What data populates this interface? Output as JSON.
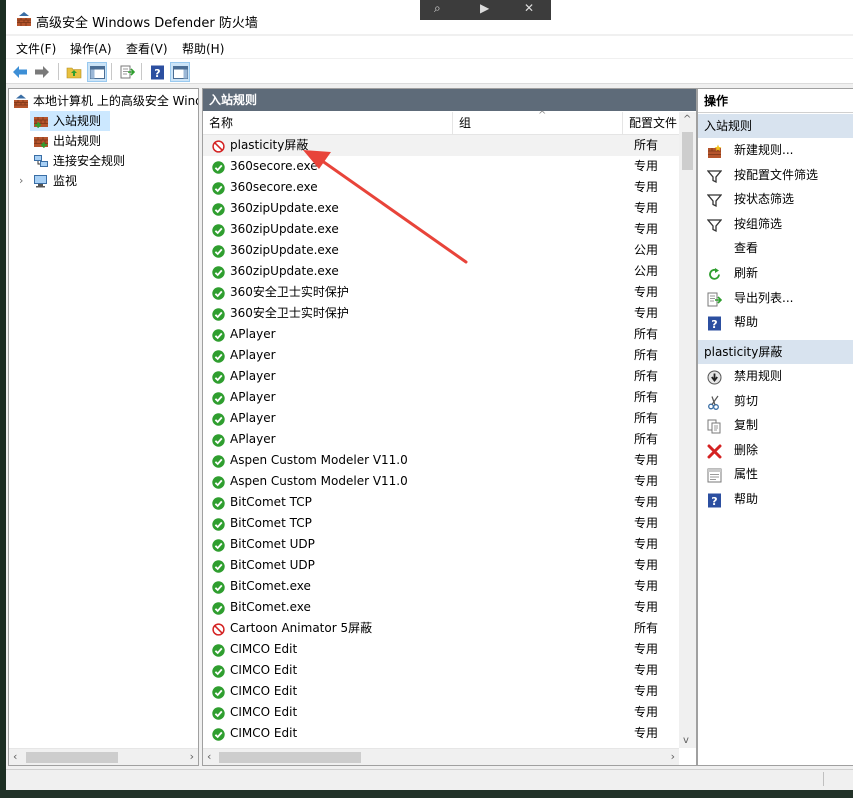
{
  "window": {
    "title": "高级安全 Windows Defender 防火墙",
    "overlay_controls": [
      "⌕",
      "▶",
      "✕"
    ]
  },
  "menu": [
    "文件(F)",
    "操作(A)",
    "查看(V)",
    "帮助(H)"
  ],
  "toolbar": {
    "icons": [
      "back-arrow-icon",
      "forward-arrow-icon",
      "up-folder-icon",
      "show-hide-tree-icon",
      "export-list-icon",
      "help-icon",
      "show-hide-action-pane-icon"
    ]
  },
  "tree": {
    "root": "本地计算机 上的高级安全 Windows Defender 防火墙",
    "items": [
      {
        "label": "入站规则",
        "icon": "inbound-rules-icon",
        "selected": true
      },
      {
        "label": "出站规则",
        "icon": "outbound-rules-icon",
        "selected": false
      },
      {
        "label": "连接安全规则",
        "icon": "connection-security-icon",
        "selected": false
      },
      {
        "label": "监视",
        "icon": "monitor-icon",
        "selected": false,
        "expandable": true
      }
    ]
  },
  "main": {
    "title": "入站规则",
    "columns": {
      "name": "名称",
      "group": "组",
      "profile": "配置文件"
    },
    "rows": [
      {
        "name": "plasticity屏蔽",
        "group": "",
        "profile": "所有",
        "status": "blocked",
        "highlighted": true
      },
      {
        "name": "360secore.exe",
        "group": "",
        "profile": "专用",
        "status": "allowed"
      },
      {
        "name": "360secore.exe",
        "group": "",
        "profile": "专用",
        "status": "allowed"
      },
      {
        "name": "360zipUpdate.exe",
        "group": "",
        "profile": "专用",
        "status": "allowed"
      },
      {
        "name": "360zipUpdate.exe",
        "group": "",
        "profile": "专用",
        "status": "allowed"
      },
      {
        "name": "360zipUpdate.exe",
        "group": "",
        "profile": "公用",
        "status": "allowed"
      },
      {
        "name": "360zipUpdate.exe",
        "group": "",
        "profile": "公用",
        "status": "allowed"
      },
      {
        "name": "360安全卫士实时保护",
        "group": "",
        "profile": "专用",
        "status": "allowed"
      },
      {
        "name": "360安全卫士实时保护",
        "group": "",
        "profile": "专用",
        "status": "allowed"
      },
      {
        "name": "APlayer",
        "group": "",
        "profile": "所有",
        "status": "allowed"
      },
      {
        "name": "APlayer",
        "group": "",
        "profile": "所有",
        "status": "allowed"
      },
      {
        "name": "APlayer",
        "group": "",
        "profile": "所有",
        "status": "allowed"
      },
      {
        "name": "APlayer",
        "group": "",
        "profile": "所有",
        "status": "allowed"
      },
      {
        "name": "APlayer",
        "group": "",
        "profile": "所有",
        "status": "allowed"
      },
      {
        "name": "APlayer",
        "group": "",
        "profile": "所有",
        "status": "allowed"
      },
      {
        "name": "Aspen Custom Modeler V11.0",
        "group": "",
        "profile": "专用",
        "status": "allowed"
      },
      {
        "name": "Aspen Custom Modeler V11.0",
        "group": "",
        "profile": "专用",
        "status": "allowed"
      },
      {
        "name": "BitComet TCP",
        "group": "",
        "profile": "专用",
        "status": "allowed"
      },
      {
        "name": "BitComet TCP",
        "group": "",
        "profile": "专用",
        "status": "allowed"
      },
      {
        "name": "BitComet UDP",
        "group": "",
        "profile": "专用",
        "status": "allowed"
      },
      {
        "name": "BitComet UDP",
        "group": "",
        "profile": "专用",
        "status": "allowed"
      },
      {
        "name": "BitComet.exe",
        "group": "",
        "profile": "专用",
        "status": "allowed"
      },
      {
        "name": "BitComet.exe",
        "group": "",
        "profile": "专用",
        "status": "allowed"
      },
      {
        "name": "Cartoon Animator 5屏蔽",
        "group": "",
        "profile": "所有",
        "status": "blocked"
      },
      {
        "name": "CIMCO Edit",
        "group": "",
        "profile": "专用",
        "status": "allowed"
      },
      {
        "name": "CIMCO Edit",
        "group": "",
        "profile": "专用",
        "status": "allowed"
      },
      {
        "name": "CIMCO Edit",
        "group": "",
        "profile": "专用",
        "status": "allowed"
      },
      {
        "name": "CIMCO Edit",
        "group": "",
        "profile": "专用",
        "status": "allowed"
      },
      {
        "name": "CIMCO Edit",
        "group": "",
        "profile": "专用",
        "status": "allowed"
      }
    ]
  },
  "actions": {
    "header": "操作",
    "section1": {
      "title": "入站规则",
      "items": [
        {
          "label": "新建规则...",
          "icon": "new-rule-icon"
        },
        {
          "label": "按配置文件筛选",
          "icon": "filter-icon"
        },
        {
          "label": "按状态筛选",
          "icon": "filter-icon"
        },
        {
          "label": "按组筛选",
          "icon": "filter-icon"
        },
        {
          "label": "查看",
          "icon": ""
        },
        {
          "label": "刷新",
          "icon": "refresh-icon"
        },
        {
          "label": "导出列表...",
          "icon": "export-list-icon"
        },
        {
          "label": "帮助",
          "icon": "help-icon"
        }
      ]
    },
    "section2": {
      "title": "plasticity屏蔽",
      "items": [
        {
          "label": "禁用规则",
          "icon": "disable-rule-icon"
        },
        {
          "label": "剪切",
          "icon": "cut-icon"
        },
        {
          "label": "复制",
          "icon": "copy-icon"
        },
        {
          "label": "删除",
          "icon": "delete-icon"
        },
        {
          "label": "属性",
          "icon": "properties-icon"
        },
        {
          "label": "帮助",
          "icon": "help-icon"
        }
      ]
    }
  },
  "colors": {
    "pane_header": "#5e6b79",
    "section_header": "#d8e3ef",
    "selection": "#cce8ff",
    "allowed_green": "#2f9e2f",
    "blocked_red": "#d42222",
    "annotation_arrow": "#e8443a"
  }
}
